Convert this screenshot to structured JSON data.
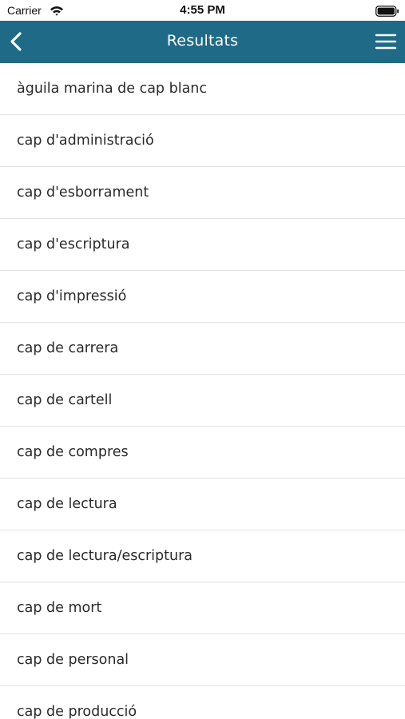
{
  "status_bar": {
    "carrier": "Carrier",
    "time": "4:55 PM"
  },
  "nav": {
    "title": "Resultats",
    "back_icon": "chevron-left-icon",
    "menu_icon": "hamburger-menu-icon",
    "background": "#1f6a86"
  },
  "results": [
    "àguila marina de cap blanc",
    "cap d'administració",
    "cap d'esborrament",
    "cap d'escriptura",
    "cap d'impressió",
    "cap de carrera",
    "cap de cartell",
    "cap de compres",
    "cap de lectura",
    "cap de lectura/escriptura",
    "cap de mort",
    "cap de personal",
    "cap de producció"
  ]
}
